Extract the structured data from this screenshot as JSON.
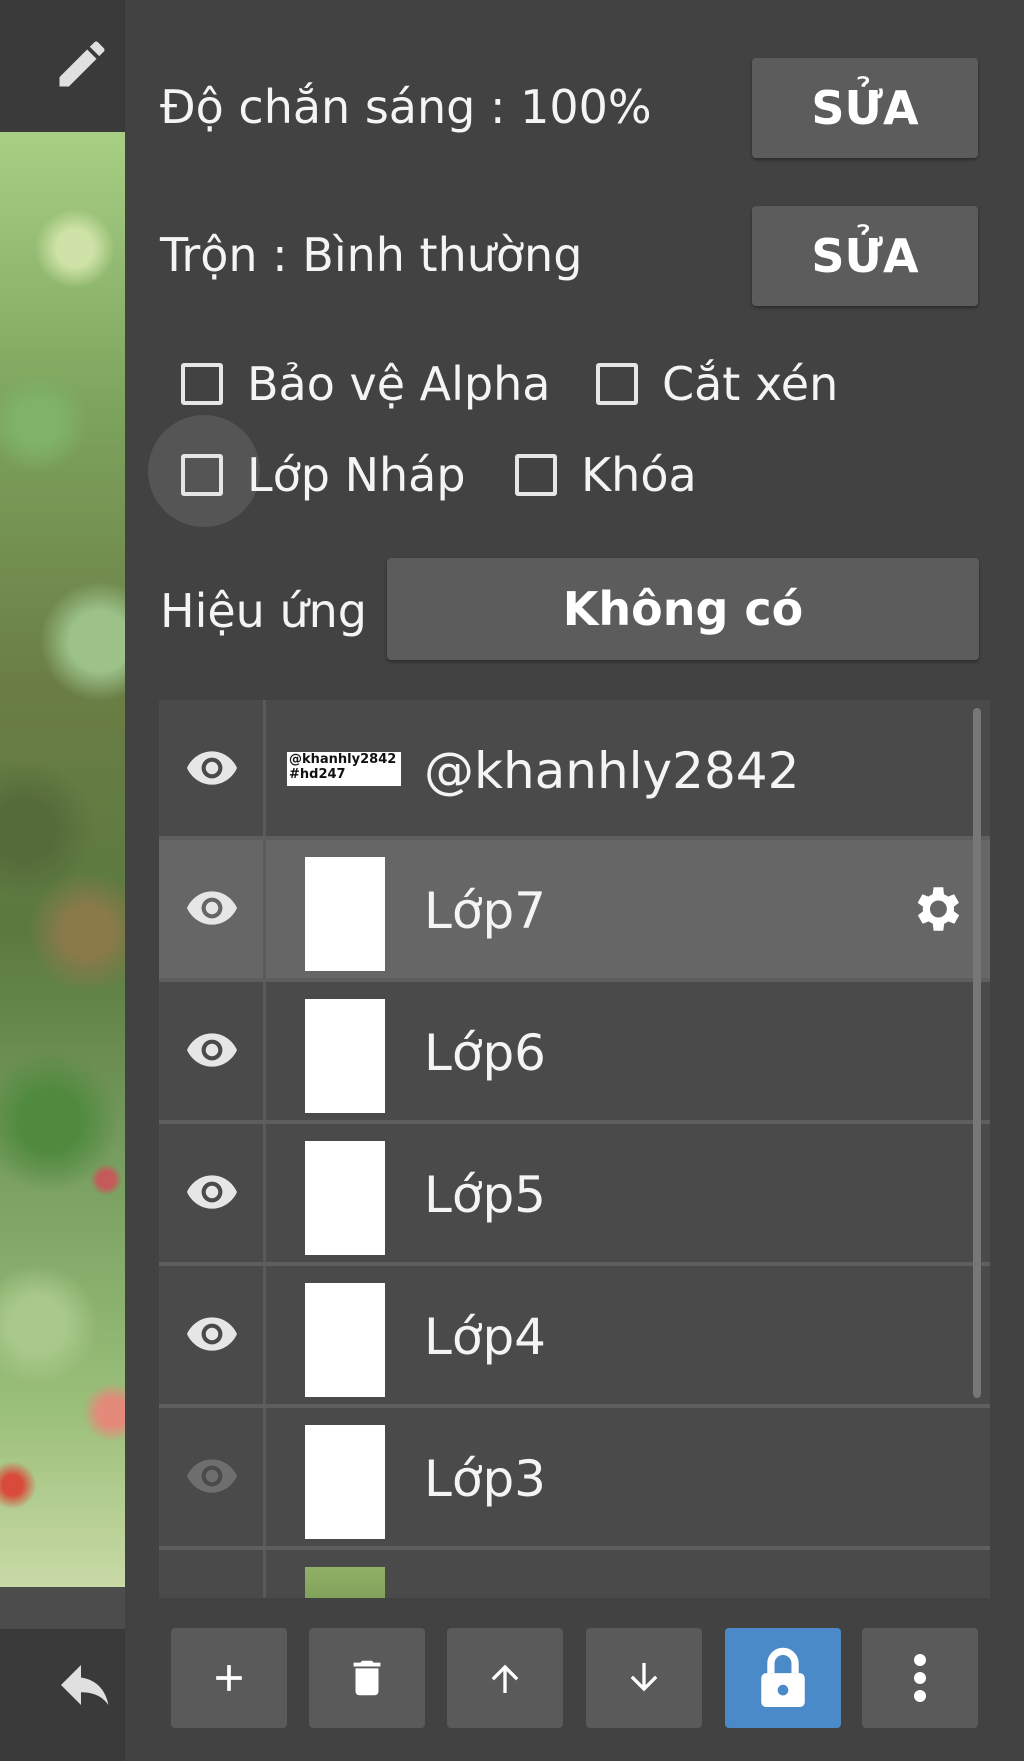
{
  "canvas": {
    "artwork": "forest-painting"
  },
  "layer_props": {
    "opacity_label": "Độ chắn sáng : 100%",
    "blend_label": "Trộn : Bình thường",
    "edit_label": "SỬA"
  },
  "options": {
    "protect_alpha": "Bảo vệ Alpha",
    "clipping": "Cắt xén",
    "draft_layer": "Lớp Nháp",
    "lock": "Khóa"
  },
  "effect": {
    "label": "Hiệu ứng",
    "value": "Không có"
  },
  "layers": [
    {
      "name": "@khanhly2842",
      "thumb_line1": "@khanhly2842",
      "thumb_line2": "#hd247",
      "visible": true
    },
    {
      "name": "Lớp7",
      "visible": true,
      "selected": true
    },
    {
      "name": "Lớp6",
      "visible": true
    },
    {
      "name": "Lớp5",
      "visible": true
    },
    {
      "name": "Lớp4",
      "visible": true
    },
    {
      "name": "Lớp3",
      "visible": false
    }
  ],
  "toolbar": [
    "add-icon",
    "trash-icon",
    "arrow-up-icon",
    "arrow-down-icon",
    "lock-icon",
    "more-vertical-icon"
  ],
  "colors": {
    "panel": "#424242",
    "button": "#5c5c5c",
    "active": "#4a8ac8"
  }
}
